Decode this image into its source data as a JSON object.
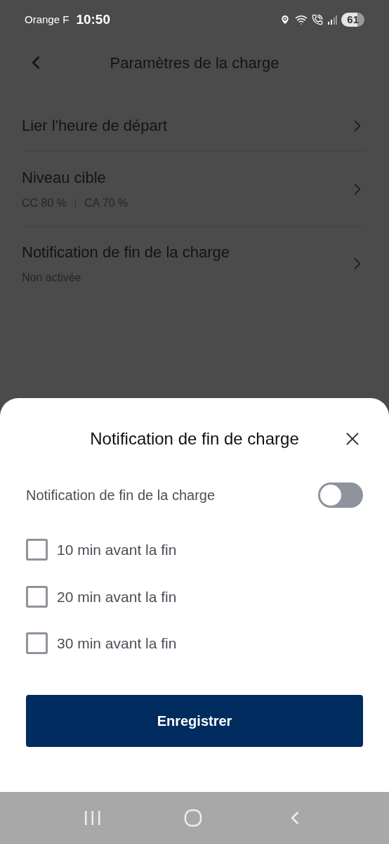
{
  "status_bar": {
    "carrier": "Orange F",
    "time": "10:50",
    "battery": "61"
  },
  "header": {
    "title": "Paramètres de la charge"
  },
  "settings": [
    {
      "title": "Lier l'heure de départ"
    },
    {
      "title": "Niveau cible",
      "details": [
        "CC 80 %",
        "CA 70 %"
      ]
    },
    {
      "title": "Notification de fin de la charge",
      "details": [
        "Non activée"
      ]
    }
  ],
  "sheet": {
    "title": "Notification de fin de charge",
    "toggle": {
      "label": "Notification de fin de la charge",
      "on": false
    },
    "options": [
      {
        "label": "10 min avant la fin",
        "checked": false
      },
      {
        "label": "20 min avant la fin",
        "checked": false
      },
      {
        "label": "30 min avant la fin",
        "checked": false
      }
    ],
    "button": "Enregistrer"
  }
}
